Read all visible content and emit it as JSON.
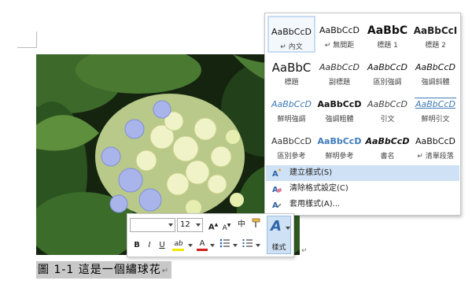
{
  "document": {
    "caption": "圖 1-1  這是一個繡球花",
    "paragraph_mark": "↵"
  },
  "gallery": {
    "styles": [
      {
        "sample": "AaBbCcD",
        "name": "↵ 內文",
        "kind": "normal",
        "selected": true
      },
      {
        "sample": "AaBbCcD",
        "name": "↵ 無間距",
        "kind": "normal"
      },
      {
        "sample": "AaBbC",
        "name": "標題 1",
        "kind": "h1"
      },
      {
        "sample": "AaBbCcI",
        "name": "標題 2",
        "kind": "h2"
      },
      {
        "sample": "AaBbC",
        "name": "標題",
        "kind": "title"
      },
      {
        "sample": "AaBbCcD",
        "name": "副標題",
        "kind": "sub"
      },
      {
        "sample": "AaBbCcD",
        "name": "區別強調",
        "kind": "em"
      },
      {
        "sample": "AaBbCcD",
        "name": "強調斜體",
        "kind": "em"
      },
      {
        "sample": "AaBbCcD",
        "name": "鮮明強調",
        "kind": "blueital"
      },
      {
        "sample": "AaBbCcD",
        "name": "強調粗體",
        "kind": "bold"
      },
      {
        "sample": "AaBbCcD",
        "name": "引文",
        "kind": "quote"
      },
      {
        "sample": "AaBbCcD",
        "name": "鮮明引文",
        "kind": "bluequote"
      },
      {
        "sample": "AaBbCcD",
        "name": "區別參考",
        "kind": "ref"
      },
      {
        "sample": "AaBbCcD",
        "name": "鮮明參考",
        "kind": "blueref"
      },
      {
        "sample": "AaBbCcD",
        "name": "書名",
        "kind": "book"
      },
      {
        "sample": "AaBbCcD",
        "name": "↵ 清單段落",
        "kind": "list"
      }
    ],
    "menu": [
      {
        "label": "建立樣式(S)",
        "icon": "new-style-icon",
        "hover": true
      },
      {
        "label": "清除格式設定(C)",
        "icon": "clear-formatting-icon"
      },
      {
        "label": "套用樣式(A)...",
        "icon": "apply-styles-icon"
      }
    ]
  },
  "minibar": {
    "font_name": "",
    "font_size": "12",
    "grow": "A",
    "shrink": "A",
    "phonetic": "中",
    "bold": "B",
    "italic": "I",
    "underline": "U",
    "highlight": "ab",
    "font_color": "A",
    "styles_label": "樣式",
    "styles_glyph": "A",
    "accent": "#2f64a8",
    "highlight_color": "#f4e600",
    "font_color_value": "#d21f1f"
  }
}
